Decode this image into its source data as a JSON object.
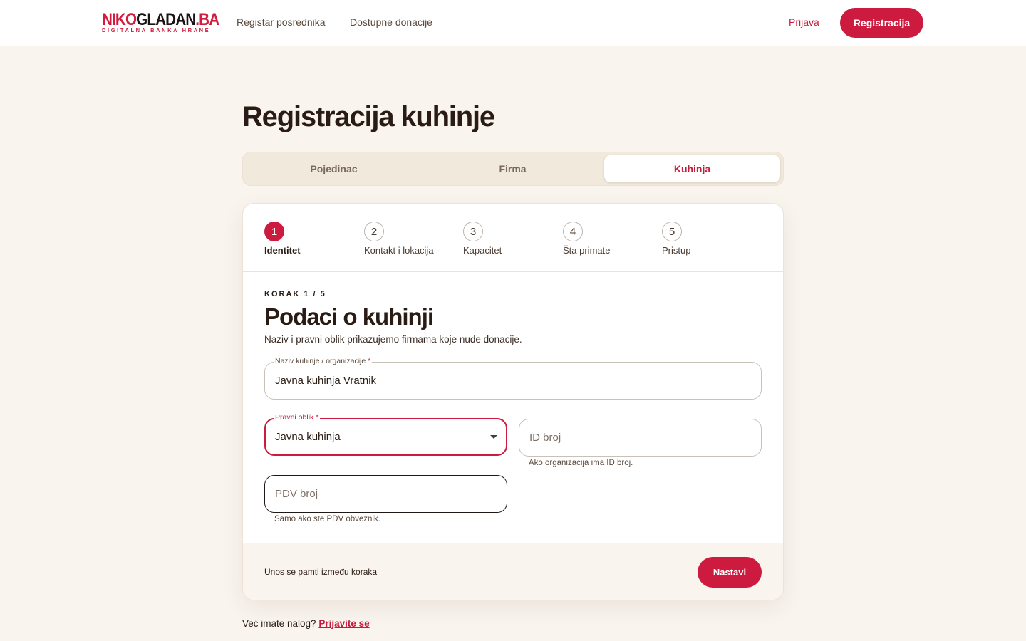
{
  "header": {
    "logo_main_red": "NIKO",
    "logo_main_dark": "GLADAN",
    "logo_main_tld": ".BA",
    "logo_sub": "DIGITALNA BANKA HRANE",
    "nav": [
      "Registar posrednika",
      "Dostupne donacije"
    ],
    "login_label": "Prijava",
    "register_label": "Registracija"
  },
  "page_title": "Registracija kuhinje",
  "tabs": [
    {
      "label": "Pojedinac",
      "active": false
    },
    {
      "label": "Firma",
      "active": false
    },
    {
      "label": "Kuhinja",
      "active": true
    }
  ],
  "stepper": [
    {
      "number": "1",
      "label": "Identitet",
      "active": true
    },
    {
      "number": "2",
      "label": "Kontakt i lokacija",
      "active": false
    },
    {
      "number": "3",
      "label": "Kapacitet",
      "active": false
    },
    {
      "number": "4",
      "label": "Šta primate",
      "active": false
    },
    {
      "number": "5",
      "label": "Pristup",
      "active": false
    }
  ],
  "form": {
    "step_kicker": "KORAK 1 / 5",
    "title": "Podaci o kuhinji",
    "description": "Naziv i pravni oblik prikazujemo firmama koje nude donacije.",
    "name_label": "Naziv kuhinje / organizacije",
    "name_value": "Javna kuhinja Vratnik",
    "legal_label": "Pravni oblik",
    "legal_value": "Javna kuhinja",
    "id_placeholder": "ID broj",
    "id_helper": "Ako organizacija ima ID broj.",
    "pdv_placeholder": "PDV broj",
    "pdv_helper": "Samo ako ste PDV obveznik.",
    "required_mark": "*"
  },
  "footer": {
    "note": "Unos se pamti između koraka",
    "next_label": "Nastavi"
  },
  "bottom": {
    "text": "Već imate nalog?",
    "link": "Prijavite se"
  },
  "colors": {
    "accent": "#cc1b3f",
    "background": "#f9f4ee"
  }
}
